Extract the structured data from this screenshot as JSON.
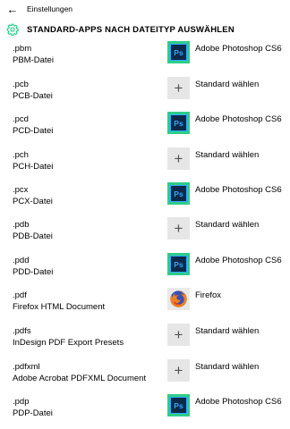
{
  "window": {
    "title": "Einstellungen"
  },
  "header": {
    "title": "STANDARD-APPS NACH DATEITYP AUSWÄHLEN"
  },
  "rows": [
    {
      "ext": ".pbm",
      "desc": "PBM-Datei",
      "app": "Adobe Photoshop CS6",
      "icon": "photoshop-icon"
    },
    {
      "ext": ".pcb",
      "desc": "PCB-Datei",
      "app": "Standard wählen",
      "icon": "plus-icon"
    },
    {
      "ext": ".pcd",
      "desc": "PCD-Datei",
      "app": "Adobe Photoshop CS6",
      "icon": "photoshop-icon"
    },
    {
      "ext": ".pch",
      "desc": "PCH-Datei",
      "app": "Standard wählen",
      "icon": "plus-icon"
    },
    {
      "ext": ".pcx",
      "desc": "PCX-Datei",
      "app": "Adobe Photoshop CS6",
      "icon": "photoshop-icon"
    },
    {
      "ext": ".pdb",
      "desc": "PDB-Datei",
      "app": "Standard wählen",
      "icon": "plus-icon"
    },
    {
      "ext": ".pdd",
      "desc": "PDD-Datei",
      "app": "Adobe Photoshop CS6",
      "icon": "photoshop-icon"
    },
    {
      "ext": ".pdf",
      "desc": "Firefox HTML Document",
      "app": "Firefox",
      "icon": "firefox-icon"
    },
    {
      "ext": ".pdfs",
      "desc": "InDesign PDF Export Presets",
      "app": "Standard wählen",
      "icon": "plus-icon"
    },
    {
      "ext": ".pdfxml",
      "desc": "Adobe Acrobat PDFXML Document",
      "app": "Standard wählen",
      "icon": "plus-icon"
    },
    {
      "ext": ".pdp",
      "desc": "PDP-Datei",
      "app": "Adobe Photoshop CS6",
      "icon": "photoshop-icon"
    }
  ],
  "icons": {
    "photoshop_label": "Ps",
    "plus_label": "+",
    "back": "←"
  },
  "colors": {
    "accent": "#2ecc8a",
    "photoshop_bg": "#0b2a4a",
    "photoshop_fg": "#31a8ff",
    "plus_bg": "#e6e6e6"
  }
}
